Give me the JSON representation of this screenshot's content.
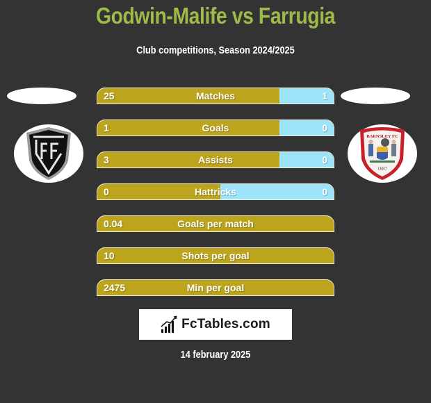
{
  "header": {
    "title": "Godwin-Malife vs Farrugia",
    "subtitle": "Club competitions, Season 2024/2025"
  },
  "players": {
    "left": {
      "club_logo": "academico-viseu-crest",
      "logo_letters": "CAF"
    },
    "right": {
      "club_logo": "barnsley-fc-crest",
      "logo_text": "BARNSLEY FC",
      "logo_year": "1887"
    }
  },
  "colors": {
    "title": "#9dbb4a",
    "left_bar": "#bca41c",
    "right_bar": "#9de3f9",
    "background": "#333333"
  },
  "stats": [
    {
      "label": "Matches",
      "left": "25",
      "right": "1",
      "right_share": 0.23
    },
    {
      "label": "Goals",
      "left": "1",
      "right": "0",
      "right_share": 0.23
    },
    {
      "label": "Assists",
      "left": "3",
      "right": "0",
      "right_share": 0.23
    },
    {
      "label": "Hattricks",
      "left": "0",
      "right": "0",
      "right_share": 0.48
    },
    {
      "label": "Goals per match",
      "left": "0.04",
      "right": null,
      "right_share": 0
    },
    {
      "label": "Shots per goal",
      "left": "10",
      "right": null,
      "right_share": 0
    },
    {
      "label": "Min per goal",
      "left": "2475",
      "right": null,
      "right_share": 0
    }
  ],
  "footer": {
    "brand": "FcTables.com",
    "brand_icon": "bar-chart-icon",
    "date": "14 february 2025"
  }
}
